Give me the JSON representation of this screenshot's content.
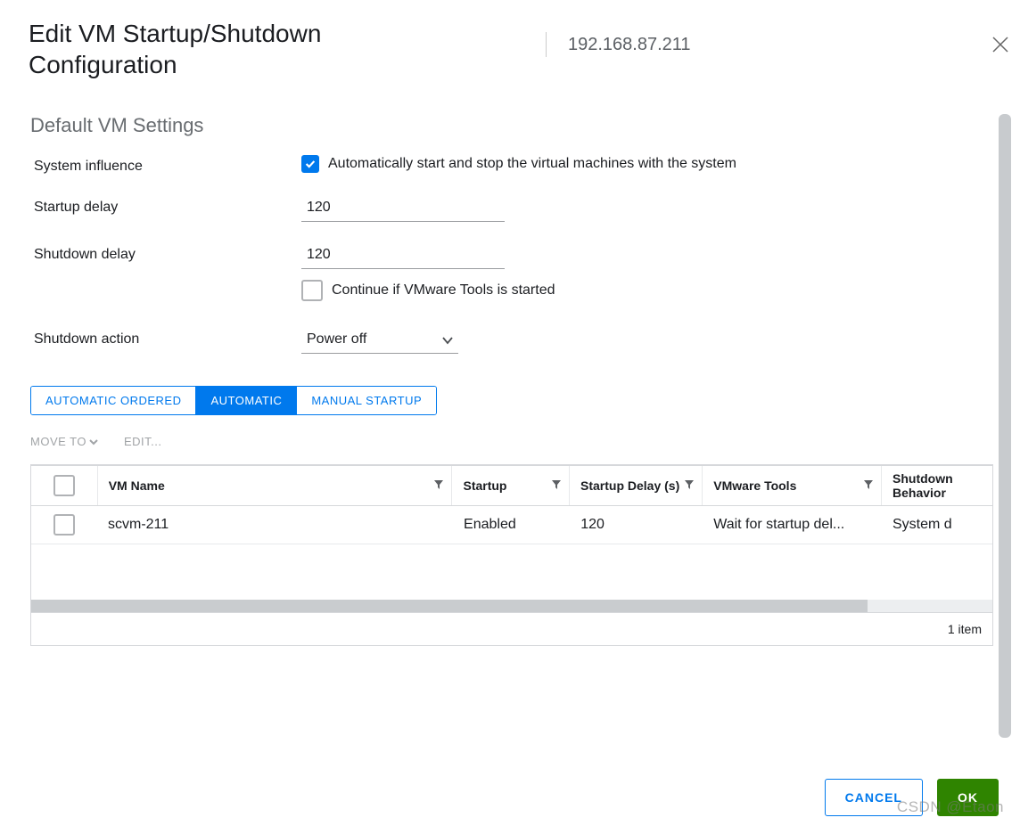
{
  "header": {
    "title": "Edit VM Startup/Shutdown Configuration",
    "ip": "192.168.87.211"
  },
  "section": {
    "title": "Default VM Settings"
  },
  "form": {
    "system_influence_label": "System influence",
    "auto_start_label": "Automatically start and stop the virtual machines with the system",
    "startup_delay_label": "Startup delay",
    "startup_delay_value": "120",
    "shutdown_delay_label": "Shutdown delay",
    "shutdown_delay_value": "120",
    "continue_label": "Continue if VMware Tools is started",
    "shutdown_action_label": "Shutdown action",
    "shutdown_action_value": "Power off"
  },
  "tabs": {
    "auto_ordered": "AUTOMATIC ORDERED",
    "automatic": "AUTOMATIC",
    "manual": "MANUAL STARTUP"
  },
  "actions": {
    "moveto": "MOVE TO",
    "edit": "EDIT..."
  },
  "grid": {
    "headers": {
      "name": "VM Name",
      "startup": "Startup",
      "delay": "Startup Delay (s)",
      "tools": "VMware Tools",
      "behavior": "Shutdown Behavior"
    },
    "row": {
      "name": "scvm-211",
      "startup": "Enabled",
      "delay": "120",
      "tools": "Wait for startup del...",
      "behavior": "System d"
    },
    "footer": "1 item"
  },
  "buttons": {
    "cancel": "CANCEL",
    "ok": "OK"
  },
  "watermark": "CSDN @Etaon"
}
